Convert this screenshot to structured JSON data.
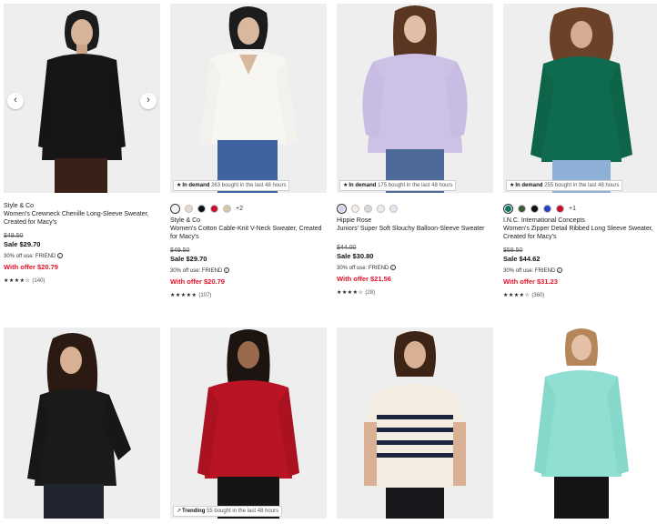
{
  "products": [
    {
      "brand": "Style & Co",
      "name": "Women's Crewneck Chenille Long-Sleeve Sweater, Created for Macy's",
      "original_price": "$49.50",
      "sale_price": "Sale $29.70",
      "promo": "30% off use: FRIEND",
      "offer_price": "With offer $20.79",
      "stars": "★★★★☆",
      "review_count": "(140)",
      "rating": 4.5
    },
    {
      "badge_label": "In demand",
      "badge_text": "263 bought in the last 48 hours",
      "swatches": [
        "#f2f2f2",
        "#e8d9cf",
        "#111111",
        "#c8102e",
        "#d8c8a8"
      ],
      "more_swatches": "+2",
      "brand": "Style & Co",
      "name": "Women's Cotton Cable-Knit V-Neck Sweater, Created for Macy's",
      "original_price": "$49.50",
      "sale_price": "Sale $29.70",
      "promo": "30% off use: FRIEND",
      "offer_price": "With offer $20.79",
      "stars": "★★★★★",
      "review_count": "(107)",
      "rating": 4.7
    },
    {
      "badge_label": "In demand",
      "badge_text": "175 bought in the last 48 hours",
      "swatches": [
        "#d8d0ec",
        "#f3ede4",
        "#d7d7d7",
        "#ededed",
        "#e6e6f2"
      ],
      "brand": "Hippie Rose",
      "name": "Juniors' Super Soft Slouchy Balloon-Sleeve Sweater",
      "original_price": "$44.00",
      "sale_price": "Sale $30.80",
      "promo": "30% off use: FRIEND",
      "offer_price": "With offer $21.56",
      "stars": "★★★★☆",
      "review_count": "(28)",
      "rating": 4.4
    },
    {
      "badge_label": "In demand",
      "badge_text": "255 bought in the last 48 hours",
      "swatches": [
        "#0d7a5f",
        "#3a5a3a",
        "#111111",
        "#2a3fbf",
        "#c8102e"
      ],
      "more_swatches": "+1",
      "brand": "I.N.C. International Concepts",
      "name": "Women's Zipper Detail Ribbed Long Sleeve Sweater, Created for Macy's",
      "original_price": "$59.50",
      "sale_price": "Sale $44.62",
      "promo": "30% off use: FRIEND",
      "offer_price": "With offer $31.23",
      "stars": "★★★★☆",
      "review_count": "(360)",
      "rating": 4.2
    },
    {
      "sweater_color": "#1a1a1a"
    },
    {
      "sweater_color": "#b81424",
      "badge_label": "Trending",
      "badge_text": "55 bought in the last 48 hours"
    },
    {
      "sweater_color": "#f3ece0"
    },
    {
      "sweater_color": "#8fe0d3"
    }
  ],
  "colors": {
    "offer_red": "#e0112b",
    "photo_bg": "#eeeeee"
  },
  "icons": {
    "prev": "‹",
    "next": "›",
    "demand": "★",
    "trending": "↗",
    "info": "i"
  }
}
